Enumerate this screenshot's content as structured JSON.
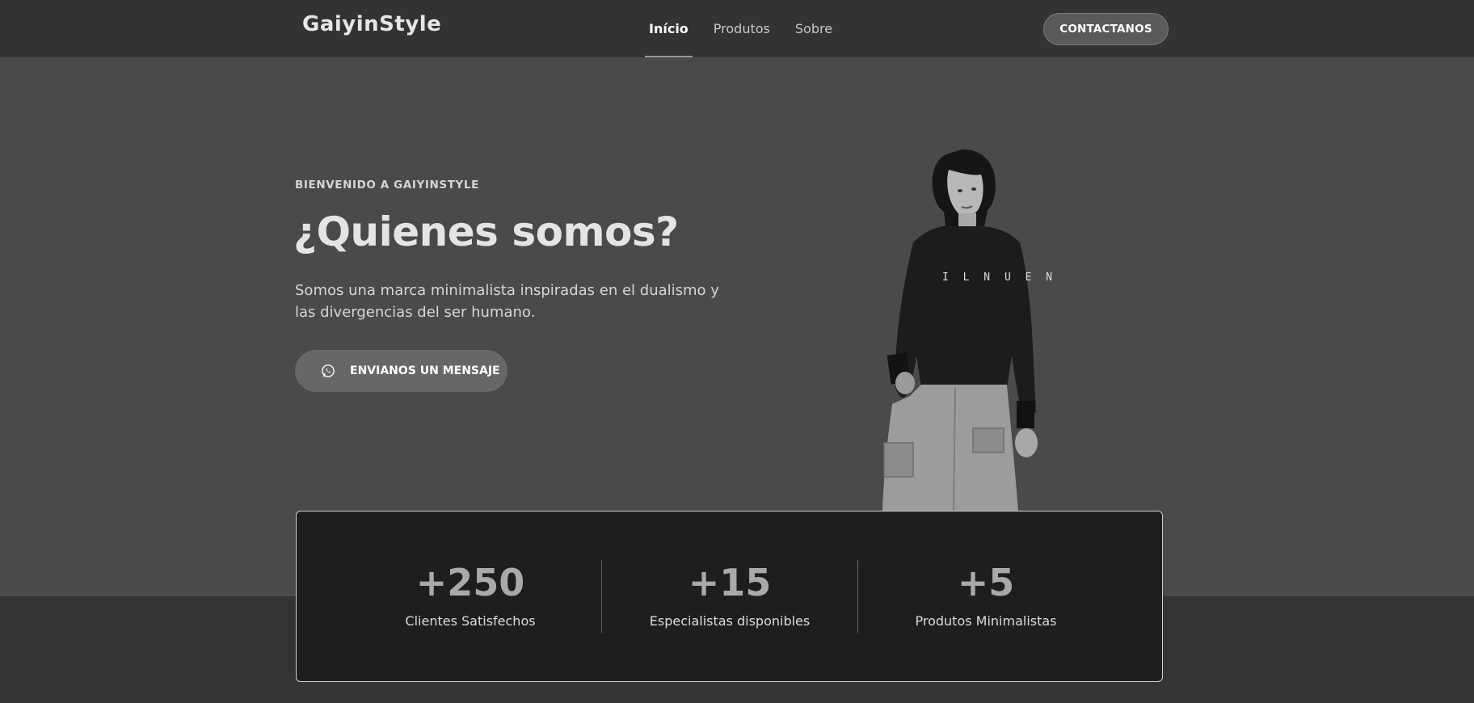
{
  "header": {
    "logo": "GaiyinStyle",
    "nav": [
      {
        "label": "Início",
        "active": true
      },
      {
        "label": "Produtos",
        "active": false
      },
      {
        "label": "Sobre",
        "active": false
      }
    ],
    "contact_label": "CONTACTANOS"
  },
  "hero": {
    "eyebrow": "BIENVENIDO A GAIYINSTYLE",
    "title": "¿Quienes somos?",
    "description": "Somos una marca minimalista inspiradas en el dualismo y las divergencias del ser humano.",
    "button_label": "ENVIANOS UN MENSAJE",
    "button_icon": "whatsapp-icon",
    "image_alt": "person-photo"
  },
  "stats": [
    {
      "value": "+250",
      "label": "Clientes Satisfechos"
    },
    {
      "value": "+15",
      "label": "Especialistas disponibles"
    },
    {
      "value": "+5",
      "label": "Produtos Minimalistas"
    }
  ],
  "colors": {
    "header_bg": "#333333",
    "hero_bg": "#4a4a4a",
    "page_bg": "#343434",
    "card_bg": "#1e1e1e",
    "button_bg": "#676767"
  }
}
